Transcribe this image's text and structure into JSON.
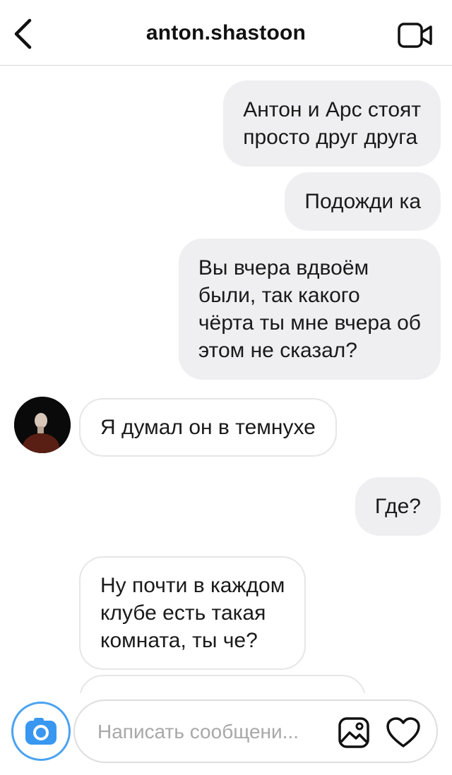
{
  "header": {
    "title": "anton.shastoon",
    "back_icon": "chevron-left-icon",
    "video_icon": "video-camera-icon"
  },
  "messages": [
    {
      "side": "outgoing",
      "text": "Антон и Арс стоят\nпросто друг друга"
    },
    {
      "side": "outgoing",
      "text": "Подожди ка"
    },
    {
      "side": "outgoing",
      "text": "Вы вчера вдвоём\nбыли, так какого\nчёрта ты мне вчера об\nэтом не сказал?"
    },
    {
      "side": "incoming",
      "text": "Я думал он в темнухе"
    },
    {
      "side": "outgoing",
      "text": "Где?"
    },
    {
      "side": "incoming",
      "text": "Ну почти в каждом\nклубе есть такая\nкомната, ты че?"
    },
    {
      "side": "incoming",
      "text": ""
    }
  ],
  "composer": {
    "placeholder": "Написать сообщени...",
    "value": "",
    "camera_icon": "camera-icon",
    "gallery_icon": "image-gallery-icon",
    "like_icon": "heart-icon"
  },
  "colors": {
    "outgoing_bubble": "#efeff1",
    "incoming_border": "#e6e6e8",
    "camera_accent": "#4aa3f0",
    "text": "#111111",
    "placeholder": "#a8a8a8"
  }
}
